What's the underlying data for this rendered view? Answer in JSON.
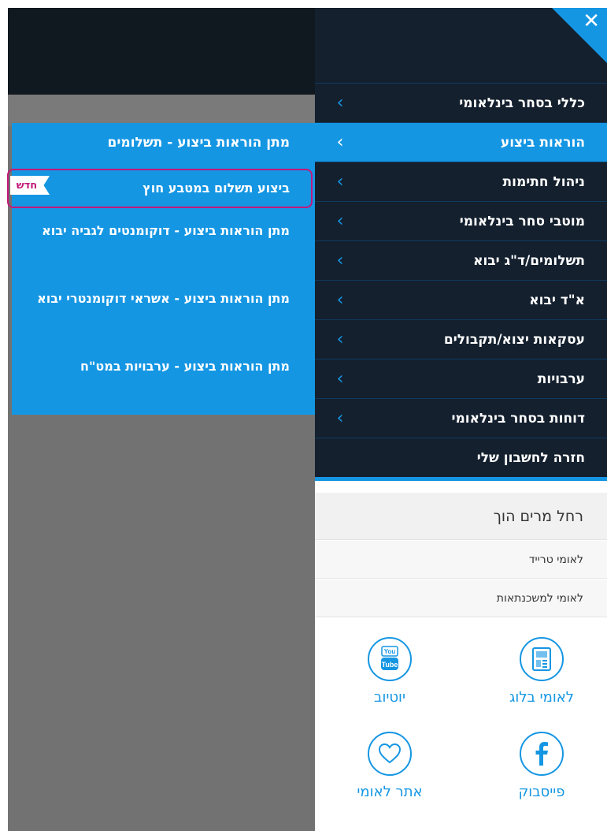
{
  "close_label": "✕",
  "menu": [
    {
      "label": "כללי בסחר בינלאומי"
    },
    {
      "label": "הוראות ביצוע",
      "active": true
    },
    {
      "label": "ניהול חתימות"
    },
    {
      "label": "מוטבי סחר בינלאומי"
    },
    {
      "label": "תשלומים/ד\"ג יבוא"
    },
    {
      "label": "א\"ד יבוא"
    },
    {
      "label": "עסקאות יצוא/תקבולים"
    },
    {
      "label": "ערבויות"
    },
    {
      "label": "דוחות בסחר בינלאומי"
    },
    {
      "label": "חזרה לחשבון שלי"
    }
  ],
  "chevron": "‹",
  "submenu": {
    "header": "מתן הוראות ביצוע - תשלומים",
    "items": [
      {
        "label": "ביצוע תשלום במטבע חוץ"
      },
      {
        "label": "מתן הוראות ביצוע - דוקומנטים לגביה יבוא"
      },
      {
        "label": "מתן הוראות ביצוע - אשראי דוקומנטרי יבוא"
      },
      {
        "label": "מתן הוראות ביצוע - ערבויות במט\"ח"
      }
    ],
    "new_badge": "חדש"
  },
  "user_name": "רחל מרים הוך",
  "links": [
    "לאומי טרייד",
    "לאומי למשכנתאות"
  ],
  "social": {
    "youtube": "יוטיוב",
    "blog": "לאומי בלוג",
    "site": "אתר לאומי",
    "facebook": "פייסבוק"
  },
  "colors": {
    "accent": "#1596e3",
    "dark": "#14202e",
    "badge": "#c2187a"
  }
}
